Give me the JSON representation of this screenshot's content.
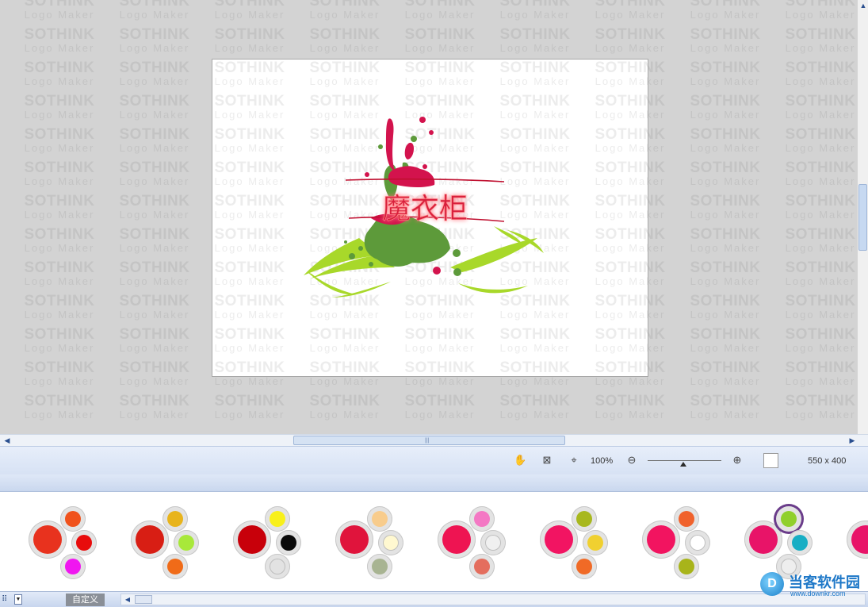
{
  "workspace": {
    "watermark": {
      "line1": "SOTHINK",
      "line2": "Logo Maker"
    }
  },
  "logo": {
    "text": "魔衣柜"
  },
  "status_bar": {
    "zoom_label": "100%",
    "zoom_level_percent": 100,
    "canvas_size": "550 x 400",
    "icons": [
      "hand-tool-icon",
      "fit-to-window-icon",
      "actual-size-icon",
      "zoom-out-icon",
      "zoom-in-icon"
    ]
  },
  "palette": {
    "tab_label": "自定义",
    "schemes": [
      {
        "main": "#e8321e",
        "top": "#f0521c",
        "right": "#e80c0c",
        "bottom": "#f016f0"
      },
      {
        "main": "#d81e14",
        "top": "#e8b41c",
        "right": "#a8e83a",
        "bottom": "#f06b18"
      },
      {
        "main": "#c8000a",
        "top": "#f8f01a",
        "right": "#0a0a0a",
        "bottom": "#e2e2e2"
      },
      {
        "main": "#e0143c",
        "top": "#f8cc8c",
        "right": "#fff8d0",
        "bottom": "#a8b492"
      },
      {
        "main": "#ee1452",
        "top": "#f478c4",
        "right": "#f0f0f0",
        "bottom": "#e46e5e"
      },
      {
        "main": "#f21462",
        "top": "#a8b81e",
        "right": "#f0d030",
        "bottom": "#f06a26"
      },
      {
        "main": "#f21460",
        "top": "#f0622c",
        "right": "#ffffff",
        "bottom": "#a8b41a"
      },
      {
        "main": "#e81468",
        "top": "#90d02c",
        "right": "#18aec4",
        "bottom": "#eeeeee"
      }
    ]
  },
  "badge": {
    "logo_letter": "D",
    "name": "当客软件园",
    "url": "www.downkr.com"
  },
  "colors": {
    "accent": "#2a4f8f",
    "logo_red": "#d3134d",
    "logo_green": "#5d9a3a",
    "logo_lime": "#a8d82a"
  }
}
